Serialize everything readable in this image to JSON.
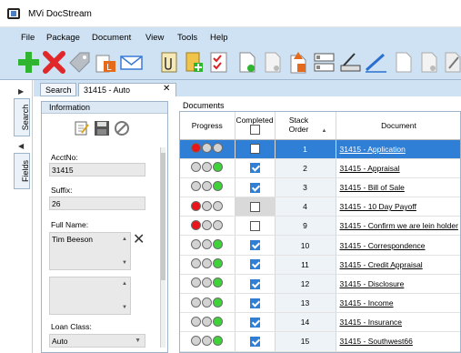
{
  "window": {
    "title": "MVi DocStream"
  },
  "menu": [
    "File",
    "Package",
    "Document",
    "View",
    "Tools",
    "Help"
  ],
  "toolbar_icons": [
    "add-icon",
    "delete-icon",
    "tag-icon",
    "package-export-icon",
    "email-icon",
    "attach-icon",
    "folder-add-icon",
    "checklist-icon",
    "new-document-icon",
    "document-icon",
    "document-upload-icon",
    "form-icon",
    "scanner-icon",
    "signature-icon",
    "blank-page-icon",
    "page-icon",
    "edit-icon"
  ],
  "sidetabs": {
    "search": "Search",
    "fields": "Fields"
  },
  "tabs": {
    "search": "Search",
    "loan": "31415 - Auto"
  },
  "info": {
    "header": "Information",
    "acctno_label": "AcctNo:",
    "acctno_value": "31415",
    "suffix_label": "Suffix:",
    "suffix_value": "26",
    "fullname_label": "Full Name:",
    "fullname_value": "Tim Beeson",
    "second_value": "",
    "loanclass_label": "Loan Class:",
    "loanclass_value": "Auto"
  },
  "documents": {
    "label": "Documents",
    "columns": {
      "progress": "Progress",
      "completed": "Completed",
      "stack": "Stack Order",
      "document": "Document"
    },
    "rows": [
      {
        "stack": "1",
        "doc": "31415 - Application",
        "progress": [
          "red",
          "gray",
          "gray"
        ],
        "completed": false,
        "selected": true
      },
      {
        "stack": "2",
        "doc": "31415 - Appraisal",
        "progress": [
          "gray",
          "gray",
          "green"
        ],
        "completed": true,
        "selected": false
      },
      {
        "stack": "3",
        "doc": "31415 - Bill of Sale",
        "progress": [
          "gray",
          "gray",
          "green"
        ],
        "completed": true,
        "selected": false
      },
      {
        "stack": "4",
        "doc": "31415 - 10 Day Payoff",
        "progress": [
          "red",
          "gray",
          "gray"
        ],
        "completed": false,
        "selected": false,
        "gray": true
      },
      {
        "stack": "9",
        "doc": "31415 - Confirm we are lein holder",
        "progress": [
          "red",
          "gray",
          "gray"
        ],
        "completed": false,
        "selected": false
      },
      {
        "stack": "10",
        "doc": "31415 - Correspondence",
        "progress": [
          "gray",
          "gray",
          "green"
        ],
        "completed": true,
        "selected": false
      },
      {
        "stack": "11",
        "doc": "31415 - Credit Appraisal",
        "progress": [
          "gray",
          "gray",
          "green"
        ],
        "completed": true,
        "selected": false
      },
      {
        "stack": "12",
        "doc": "31415 - Disclosure",
        "progress": [
          "gray",
          "gray",
          "green"
        ],
        "completed": true,
        "selected": false
      },
      {
        "stack": "13",
        "doc": "31415 - Income",
        "progress": [
          "gray",
          "gray",
          "green"
        ],
        "completed": true,
        "selected": false
      },
      {
        "stack": "14",
        "doc": "31415 - Insurance",
        "progress": [
          "gray",
          "gray",
          "green"
        ],
        "completed": true,
        "selected": false
      },
      {
        "stack": "15",
        "doc": "31415 - Southwest66",
        "progress": [
          "gray",
          "gray",
          "green"
        ],
        "completed": true,
        "selected": false
      }
    ]
  },
  "colors": {
    "red": "#e8161b",
    "green": "#3fd33a",
    "gray": "#d3d3d3",
    "selected": "#2f7fd6",
    "chrome": "#cfe2f3"
  }
}
